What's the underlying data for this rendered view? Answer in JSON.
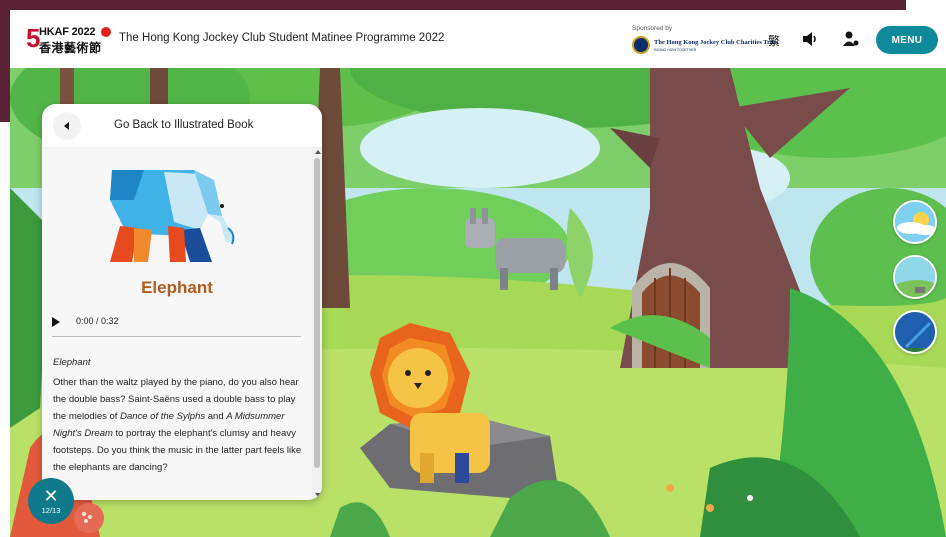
{
  "header": {
    "logo_line1": "HKAF 2022",
    "logo_line2": "香港藝術節",
    "logo_numeral": "5",
    "title": "The Hong Kong Jockey Club Student Matinee Programme 2022",
    "sponsor_label": "Sponsored by",
    "sponsor_name": "The Hong Kong Jockey Club Charities Trust",
    "sponsor_sub": "RIDING HIGH TOGETHER",
    "lang_toggle": "繁",
    "menu_label": "MENU"
  },
  "panel": {
    "back_label": "Go Back to Illustrated Book",
    "animal_name": "Elephant",
    "audio_time": "0:00  /  0:32",
    "desc_title": "Elephant",
    "desc_part1": "Other than the waltz played by the piano, do you also hear the double bass? Saint-Saëns used a double bass to play the melodies of ",
    "desc_italic1": "Dance of the Sylphs",
    "desc_part2": " and ",
    "desc_italic2": "A Midsummer Night's Dream",
    "desc_part3": " to portray the elephant's clumsy and heavy footsteps. Do you think the music in the latter part feels like the elephants are dancing?"
  },
  "navigation": {
    "close_symbol": "✕",
    "page_counter": "12/13"
  },
  "colors": {
    "accent": "#0e8a9a",
    "animal_name": "#b35c1e",
    "backdrop": "#5b2235"
  },
  "icons": [
    "back-icon",
    "sound-icon",
    "user-icon",
    "play-icon",
    "close-icon",
    "chat-bubble-icon"
  ]
}
